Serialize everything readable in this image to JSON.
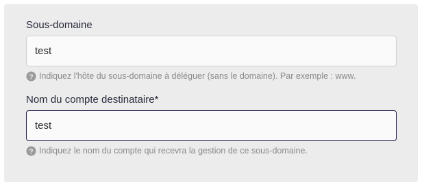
{
  "form": {
    "subdomain": {
      "label": "Sous-domaine",
      "value": "test",
      "help": "Indiquez l'hôte du sous-domaine à déléguer (sans le domaine). Par exemple : www."
    },
    "recipient": {
      "label": "Nom du compte destinataire*",
      "value": "test",
      "help": "Indiquez le nom du compte qui recevra la gestion de ce sous-domaine."
    }
  },
  "icons": {
    "help": "help-circle-icon"
  },
  "colors": {
    "panel_background": "#ececec",
    "focused_border": "#1f1d4a",
    "help_text": "#8a8a8a"
  }
}
